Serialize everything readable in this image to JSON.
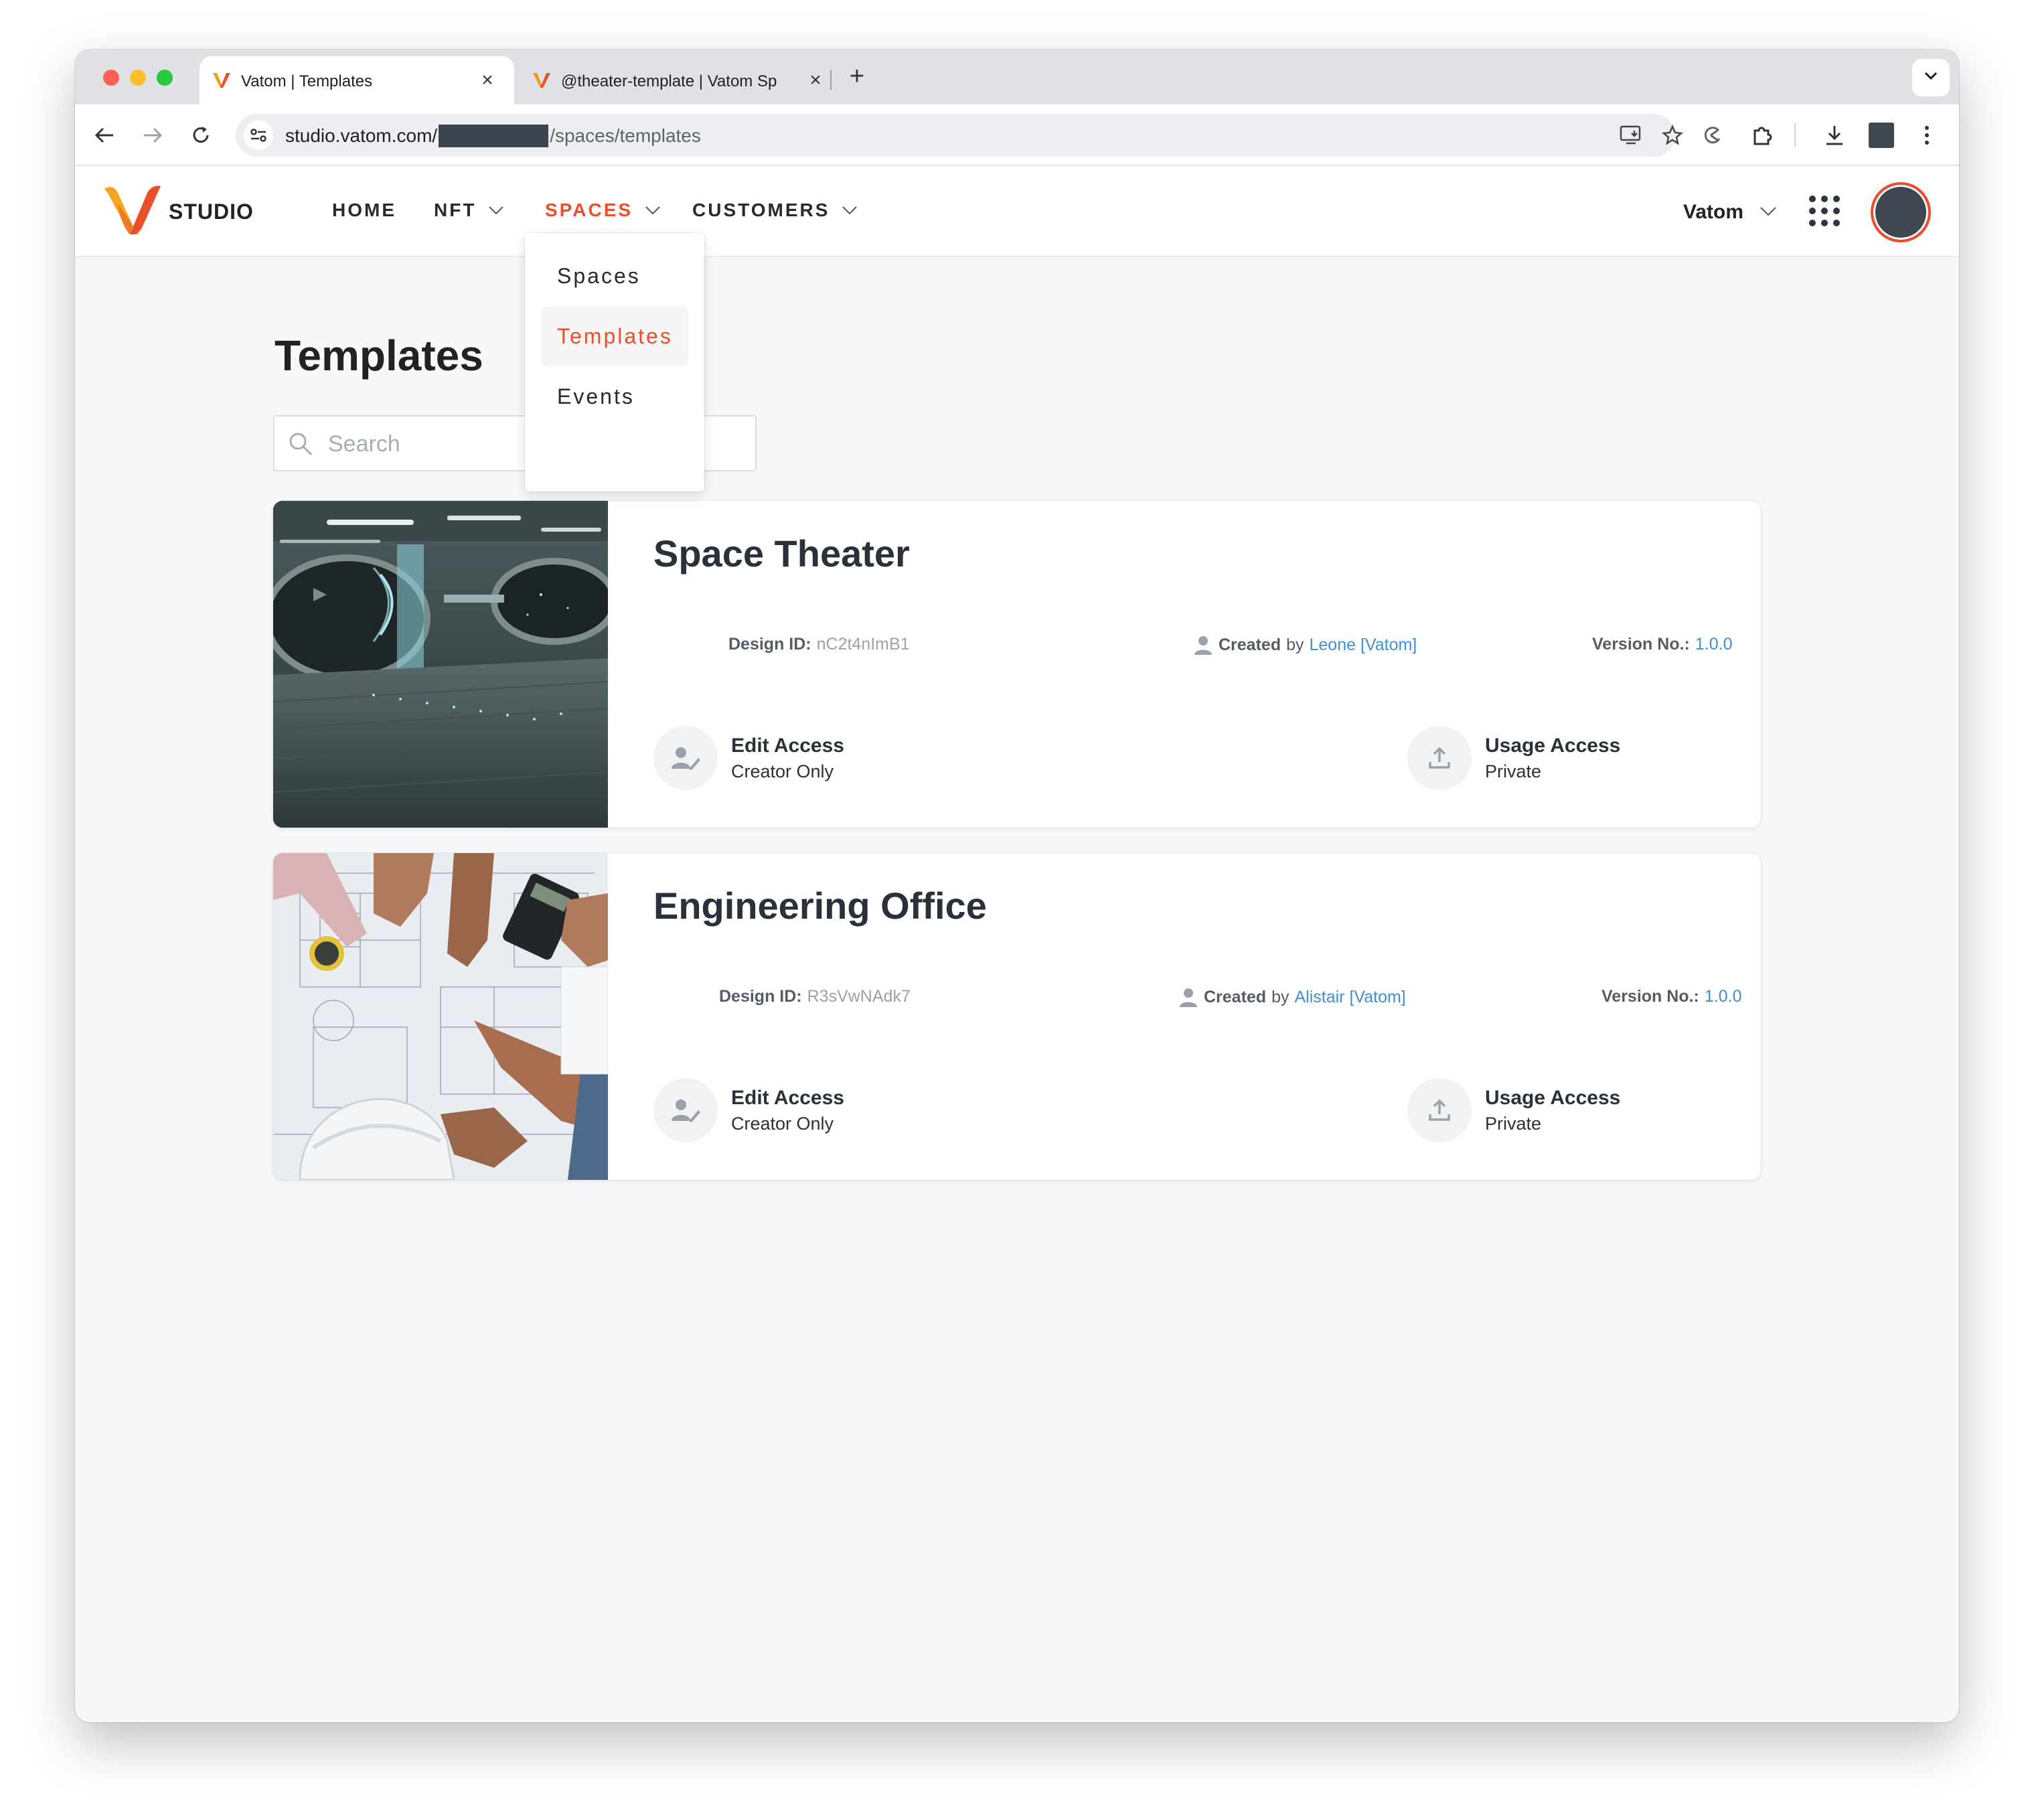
{
  "browser": {
    "tabs": [
      {
        "title": "Vatom | Templates",
        "active": true
      },
      {
        "title": "@theater-template | Vatom Sp",
        "active": false
      }
    ],
    "url_host": "studio.vatom.com/",
    "url_path": "/spaces/templates"
  },
  "app": {
    "brand": "STUDIO",
    "accent_color": "#e8502c",
    "nav": [
      {
        "label": "HOME"
      },
      {
        "label": "NFT"
      },
      {
        "label": "SPACES"
      },
      {
        "label": "CUSTOMERS"
      }
    ],
    "org_name": "Vatom",
    "spaces_menu": [
      {
        "label": "Spaces"
      },
      {
        "label": "Templates"
      },
      {
        "label": "Events"
      }
    ]
  },
  "page": {
    "title": "Templates",
    "search_placeholder": "Search"
  },
  "labels": {
    "design_id": "Design ID:",
    "created": "Created",
    "by": "by",
    "version": "Version No.:",
    "edit_access": "Edit Access",
    "usage_access": "Usage Access"
  },
  "templates": [
    {
      "name": "Space Theater",
      "design_id": "nC2t4nImB1",
      "creator": "Leone [Vatom]",
      "version": "1.0.0",
      "edit_access": "Creator Only",
      "usage_access": "Private"
    },
    {
      "name": "Engineering Office",
      "design_id": "R3sVwNAdk7",
      "creator": "Alistair [Vatom]",
      "version": "1.0.0",
      "edit_access": "Creator Only",
      "usage_access": "Private"
    }
  ]
}
